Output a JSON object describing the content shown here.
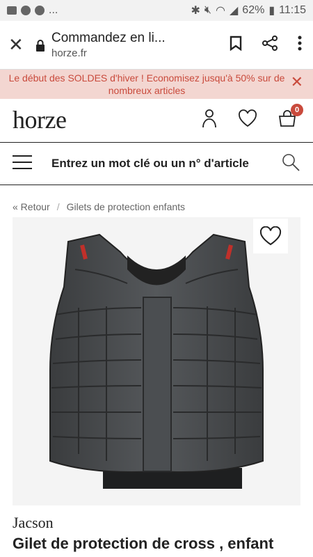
{
  "status": {
    "battery": "62%",
    "time": "11:15",
    "more": "..."
  },
  "browser": {
    "title": "Commandez en li...",
    "domain": "horze.fr"
  },
  "promo": {
    "text": "Le début des SOLDES d'hiver ! Economisez jusqu'à 50% sur de nombreux articles"
  },
  "header": {
    "logo": "horze",
    "cart_count": "0"
  },
  "search": {
    "placeholder": "Entrez un mot clé ou un n° d'article"
  },
  "breadcrumb": {
    "back": "« Retour",
    "separator": "/",
    "category": "Gilets de protection enfants"
  },
  "product": {
    "brand": "Jacson",
    "name": "Gilet de protection de cross , enfant"
  },
  "colors": {
    "accent": "#c94a3c",
    "promo_bg": "#f3d6d1"
  },
  "icons": [
    "close-icon",
    "lock-icon",
    "bookmark-icon",
    "share-icon",
    "more-icon",
    "account-icon",
    "heart-icon",
    "cart-icon",
    "menu-icon",
    "search-icon"
  ]
}
